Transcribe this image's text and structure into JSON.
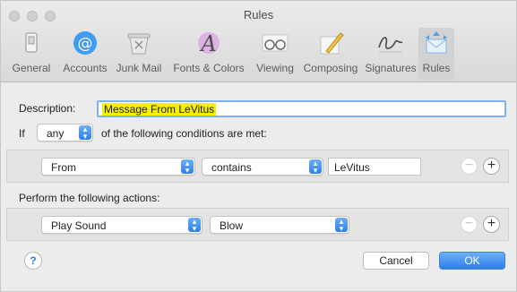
{
  "window": {
    "title": "Rules"
  },
  "toolbar": {
    "items": [
      {
        "label": "General",
        "icon": "general-switch-icon"
      },
      {
        "label": "Accounts",
        "icon": "at-sign-icon"
      },
      {
        "label": "Junk Mail",
        "icon": "junk-mail-icon"
      },
      {
        "label": "Fonts & Colors",
        "icon": "font-letter-icon"
      },
      {
        "label": "Viewing",
        "icon": "glasses-icon"
      },
      {
        "label": "Composing",
        "icon": "pencil-icon"
      },
      {
        "label": "Signatures",
        "icon": "signature-icon"
      },
      {
        "label": "Rules",
        "icon": "rules-envelope-icon",
        "selected": true
      }
    ]
  },
  "rule": {
    "description_label": "Description:",
    "description_value": "Message From LeVitus",
    "if_label": "If",
    "match_mode": "any",
    "conditions_suffix": "of the following conditions are met:",
    "condition": {
      "field": "From",
      "operator": "contains",
      "value": "LeVitus"
    },
    "actions_label": "Perform the following actions:",
    "action": {
      "type": "Play Sound",
      "value": "Blow"
    }
  },
  "buttons": {
    "help": "?",
    "cancel": "Cancel",
    "ok": "OK",
    "remove": "−",
    "add": "+"
  },
  "colors": {
    "accent": "#2f7ee8",
    "highlight": "#f5f000"
  }
}
